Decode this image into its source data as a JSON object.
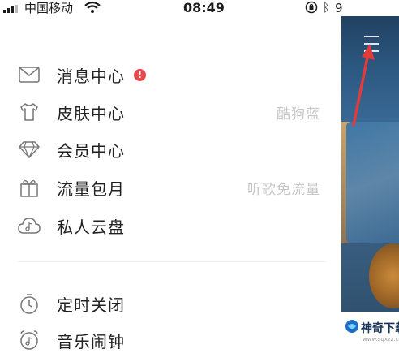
{
  "status_bar": {
    "carrier": "中国移动",
    "time": "08:49",
    "battery_text": "9"
  },
  "menu": {
    "items": [
      {
        "label": "消息中心",
        "icon": "mail-icon",
        "badge": "!"
      },
      {
        "label": "皮肤中心",
        "icon": "tshirt-icon",
        "sub": "酷狗蓝"
      },
      {
        "label": "会员中心",
        "icon": "diamond-icon"
      },
      {
        "label": "流量包月",
        "icon": "gift-icon",
        "sub": "听歌免流量"
      },
      {
        "label": "私人云盘",
        "icon": "cloud-music-icon"
      },
      {
        "label": "定时关闭",
        "icon": "timer-icon"
      },
      {
        "label": "音乐闹钟",
        "icon": "alarm-clock-icon"
      }
    ]
  },
  "watermark": {
    "name": "神奇下载",
    "url": "www.sqxzz.com"
  },
  "colors": {
    "badge": "#e8474c",
    "arrow": "#e23b3b",
    "label": "#222222",
    "sub": "#c6c6c6"
  }
}
